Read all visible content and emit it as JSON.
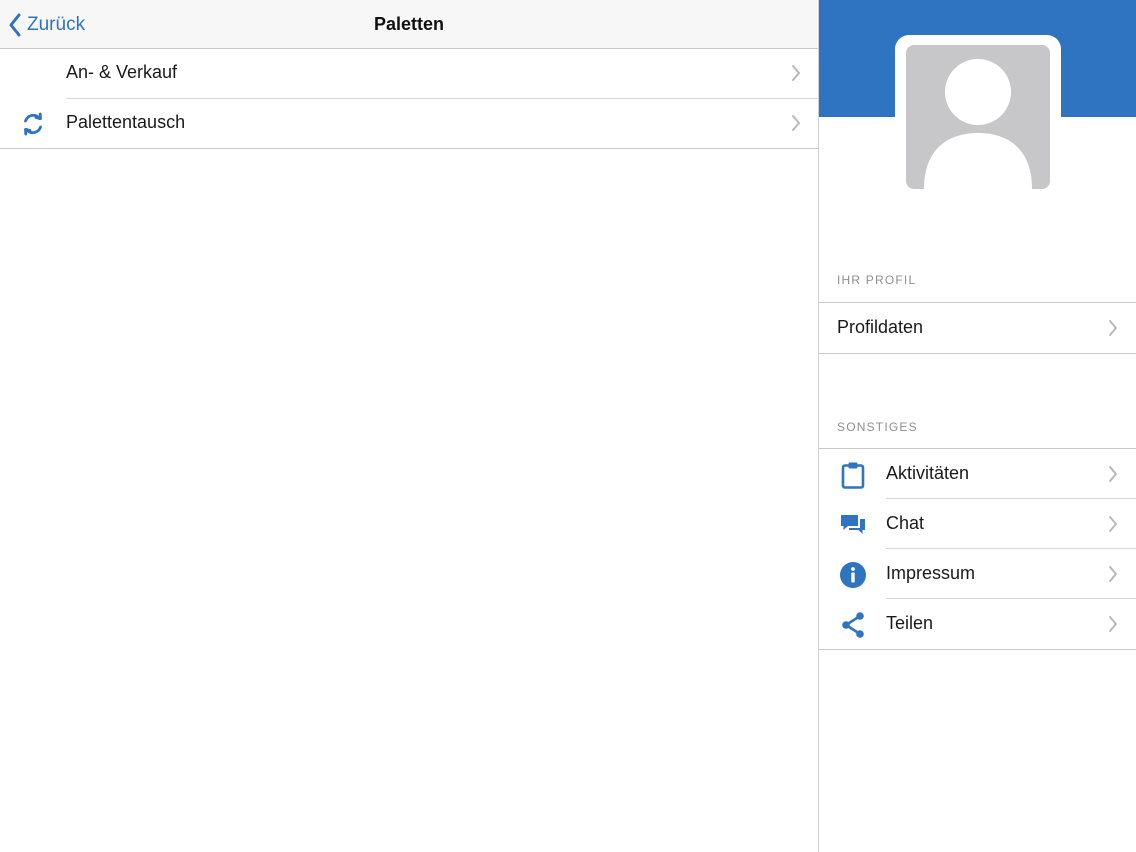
{
  "colors": {
    "accent": "#2f74c0",
    "navbar_bg": "#f7f7f8",
    "separator": "#c8c7cc",
    "avatar_placeholder": "#c7c7c9",
    "section_header_text": "#8e8e93"
  },
  "navbar": {
    "back_label": "Zurück",
    "title": "Paletten"
  },
  "menu": {
    "items": [
      {
        "label": "An- & Verkauf",
        "icon": "none"
      },
      {
        "label": "Palettentausch",
        "icon": "sync-icon"
      }
    ]
  },
  "sidebar": {
    "profile_section": {
      "header": "IHR PROFIL",
      "items": [
        {
          "label": "Profildaten"
        }
      ]
    },
    "other_section": {
      "header": "SONSTIGES",
      "items": [
        {
          "label": "Aktivitäten",
          "icon": "clipboard-icon"
        },
        {
          "label": "Chat",
          "icon": "chat-bubbles-icon"
        },
        {
          "label": "Impressum",
          "icon": "info-icon"
        },
        {
          "label": "Teilen",
          "icon": "share-icon"
        }
      ]
    }
  }
}
